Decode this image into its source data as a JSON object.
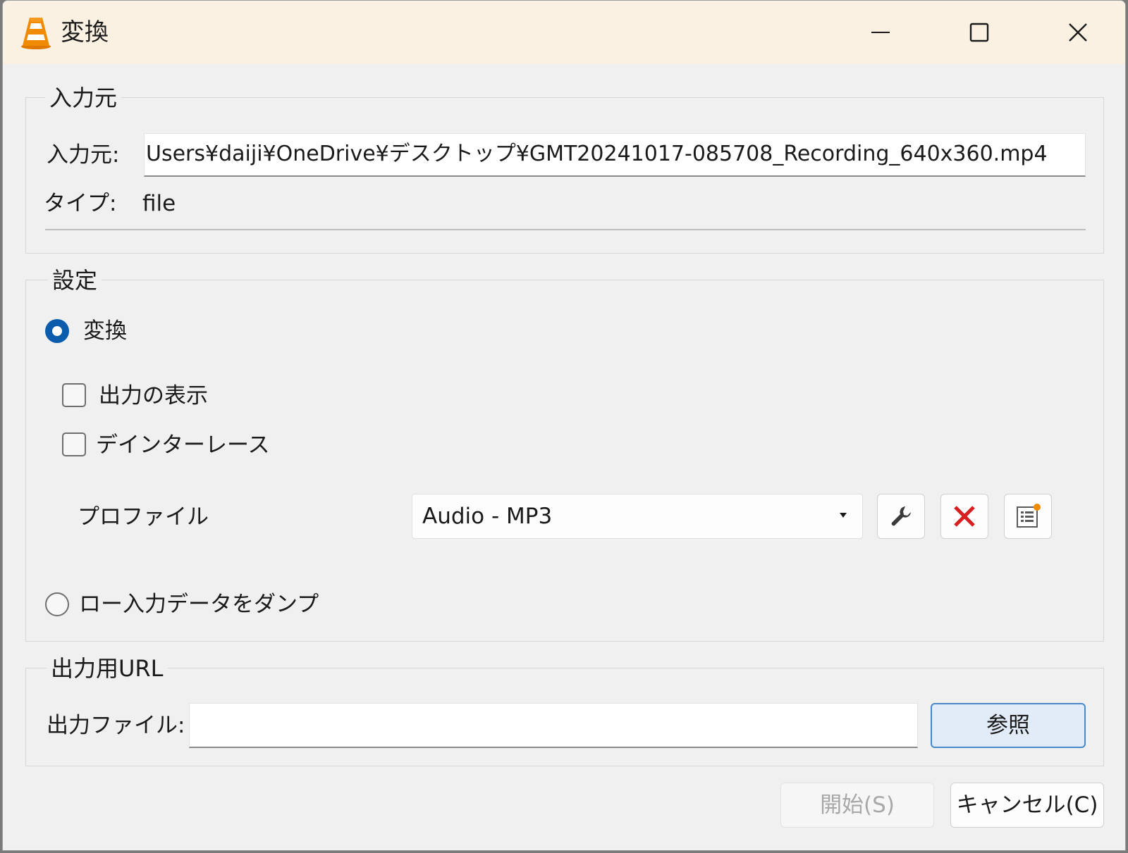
{
  "window": {
    "title": "変換",
    "icon": "vlc-cone-icon",
    "controls": [
      "minimize-icon",
      "maximize-icon",
      "close-icon"
    ]
  },
  "input_group": {
    "legend": "入力元",
    "source_label": "入力元:",
    "source_value": "Users¥daiji¥OneDrive¥デスクトップ¥GMT20241017-085708_Recording_640x360.mp4",
    "type_label": "タイプ:",
    "type_value": "file"
  },
  "settings_group": {
    "legend": "設定",
    "convert_radio_label": "変換",
    "convert_selected": true,
    "show_output_label": "出力の表示",
    "show_output_checked": false,
    "deinterlace_label": "デインターレース",
    "deinterlace_checked": false,
    "profile_label": "プロファイル",
    "profile_selected": "Audio - MP3",
    "profile_buttons": [
      "wrench-icon",
      "delete-x-icon",
      "new-profile-icon"
    ],
    "dump_radio_label": "ロー入力データをダンプ",
    "dump_selected": false
  },
  "output_group": {
    "legend": "出力用URL",
    "file_label": "出力ファイル:",
    "file_value": "",
    "browse_label": "参照"
  },
  "footer": {
    "start_label": "開始(S)",
    "start_enabled": false,
    "cancel_label": "キャンセル(C)"
  },
  "colors": {
    "titlebar": "#fbf1e3",
    "accent": "#0b5cad",
    "delete_red": "#d81e1e",
    "vlc_orange": "#f08a00"
  }
}
